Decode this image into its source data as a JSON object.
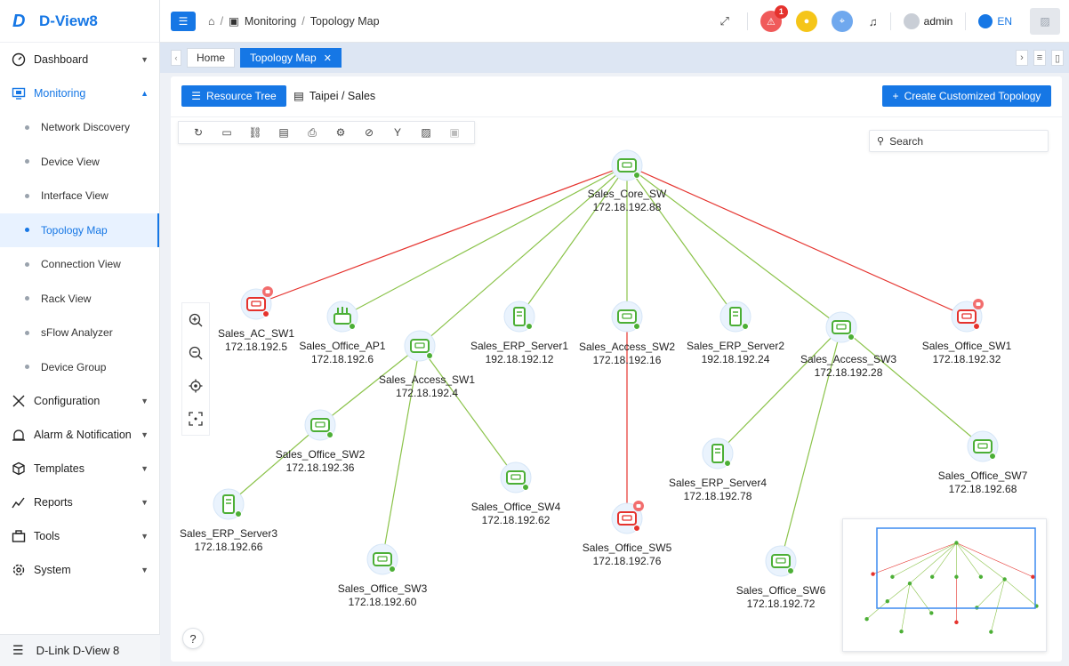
{
  "app": {
    "brand": "D-View8"
  },
  "sidebar": {
    "items": [
      {
        "label": "Dashboard",
        "icon": "dashboard-icon"
      },
      {
        "label": "Monitoring",
        "icon": "monitor-icon"
      },
      {
        "label": "Configuration",
        "icon": "tools-icon"
      },
      {
        "label": "Alarm & Notification",
        "icon": "alarm-icon"
      },
      {
        "label": "Templates",
        "icon": "cube-icon"
      },
      {
        "label": "Reports",
        "icon": "reports-icon"
      },
      {
        "label": "Tools",
        "icon": "toolbox-icon"
      },
      {
        "label": "System",
        "icon": "gear-icon"
      }
    ],
    "monitoring_sub": [
      "Network Discovery",
      "Device View",
      "Interface View",
      "Topology Map",
      "Connection View",
      "Rack View",
      "sFlow Analyzer",
      "Device Group"
    ],
    "footer": "D-Link D-View 8"
  },
  "header": {
    "breadcrumb": [
      "Monitoring",
      "Topology Map"
    ],
    "alarm_count": "1",
    "user": "admin",
    "lang": "EN"
  },
  "tabs": {
    "home": "Home",
    "active": "Topology Map"
  },
  "panel": {
    "resource_tree": "Resource Tree",
    "path": "Taipei / Sales",
    "create": "Create Customized Topology",
    "search_placeholder": "Search"
  },
  "colors": {
    "accent": "#1677e5",
    "ok": "#4caf36",
    "alarm": "#e5322d",
    "link_ok": "#8bc34a",
    "link_down": "#e5322d"
  },
  "topology": {
    "nodes": [
      {
        "id": "core",
        "name": "Sales_Core_SW",
        "ip": "172.18.192.88",
        "type": "switch",
        "status": "ok"
      },
      {
        "id": "ac1",
        "name": "Sales_AC_SW1",
        "ip": "172.18.192.5",
        "type": "switch",
        "status": "alarm"
      },
      {
        "id": "ap1",
        "name": "Sales_Office_AP1",
        "ip": "172.18.192.6",
        "type": "ap",
        "status": "ok"
      },
      {
        "id": "acc1",
        "name": "Sales_Access_SW1",
        "ip": "172.18.192.4",
        "type": "switch",
        "status": "ok"
      },
      {
        "id": "erp1",
        "name": "Sales_ERP_Server1",
        "ip": "192.18.192.12",
        "type": "server",
        "status": "ok"
      },
      {
        "id": "acc2",
        "name": "Sales_Access_SW2",
        "ip": "172.18.192.16",
        "type": "switch",
        "status": "ok"
      },
      {
        "id": "erp2",
        "name": "Sales_ERP_Server2",
        "ip": "192.18.192.24",
        "type": "server",
        "status": "ok"
      },
      {
        "id": "acc3",
        "name": "Sales_Access_SW3",
        "ip": "172.18.192.28",
        "type": "switch",
        "status": "ok"
      },
      {
        "id": "off1",
        "name": "Sales_Office_SW1",
        "ip": "172.18.192.32",
        "type": "switch",
        "status": "alarm"
      },
      {
        "id": "off2",
        "name": "Sales_Office_SW2",
        "ip": "172.18.192.36",
        "type": "switch",
        "status": "ok"
      },
      {
        "id": "erp3",
        "name": "Sales_ERP_Server3",
        "ip": "172.18.192.66",
        "type": "server",
        "status": "ok"
      },
      {
        "id": "off3",
        "name": "Sales_Office_SW3",
        "ip": "172.18.192.60",
        "type": "switch",
        "status": "ok"
      },
      {
        "id": "off4",
        "name": "Sales_Office_SW4",
        "ip": "172.18.192.62",
        "type": "switch",
        "status": "ok"
      },
      {
        "id": "off5",
        "name": "Sales_Office_SW5",
        "ip": "172.18.192.76",
        "type": "switch",
        "status": "alarm"
      },
      {
        "id": "erp4",
        "name": "Sales_ERP_Server4",
        "ip": "172.18.192.78",
        "type": "server",
        "status": "ok"
      },
      {
        "id": "off6",
        "name": "Sales_Office_SW6",
        "ip": "172.18.192.72",
        "type": "switch",
        "status": "ok"
      },
      {
        "id": "off7",
        "name": "Sales_Office_SW7",
        "ip": "172.18.192.68",
        "type": "switch",
        "status": "ok"
      }
    ],
    "links": [
      {
        "from": "core",
        "to": "ac1",
        "status": "down"
      },
      {
        "from": "core",
        "to": "ap1",
        "status": "up"
      },
      {
        "from": "core",
        "to": "acc1",
        "status": "up"
      },
      {
        "from": "core",
        "to": "erp1",
        "status": "up"
      },
      {
        "from": "core",
        "to": "acc2",
        "status": "up"
      },
      {
        "from": "core",
        "to": "erp2",
        "status": "up"
      },
      {
        "from": "core",
        "to": "acc3",
        "status": "up"
      },
      {
        "from": "core",
        "to": "off1",
        "status": "down"
      },
      {
        "from": "acc1",
        "to": "off2",
        "status": "up"
      },
      {
        "from": "acc1",
        "to": "off3",
        "status": "up"
      },
      {
        "from": "acc1",
        "to": "off4",
        "status": "up"
      },
      {
        "from": "off2",
        "to": "erp3",
        "status": "up"
      },
      {
        "from": "acc2",
        "to": "off5",
        "status": "down"
      },
      {
        "from": "acc3",
        "to": "erp4",
        "status": "up"
      },
      {
        "from": "acc3",
        "to": "off6",
        "status": "up"
      },
      {
        "from": "acc3",
        "to": "off7",
        "status": "up"
      }
    ]
  }
}
